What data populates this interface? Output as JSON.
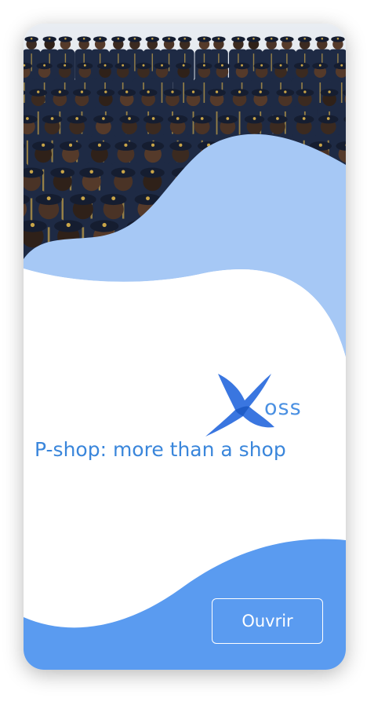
{
  "brand": {
    "name": "OSS",
    "logo_icon": "bird-x-logo-icon",
    "accent_color": "#4a90e2"
  },
  "tagline": "P-shop: more than a shop",
  "hero": {
    "photo": "group-of-uniformed-cadets-photo"
  },
  "cta": {
    "open_label": "Ouvrir"
  },
  "colors": {
    "light_wave": "#a6c8f5",
    "dark_wave": "#5a9bf0",
    "uniform": "#1e2a44"
  }
}
